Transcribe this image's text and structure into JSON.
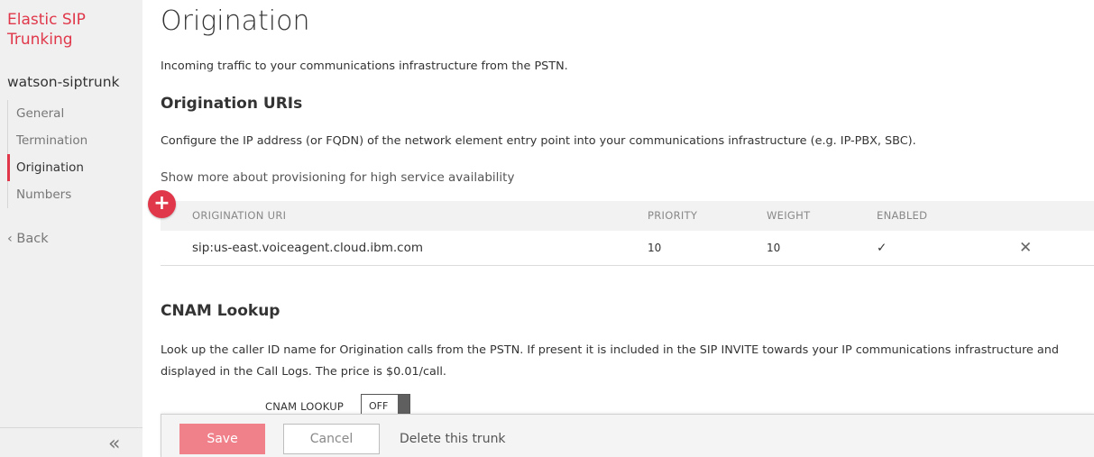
{
  "sidebar": {
    "app_title": "Elastic SIP Trunking",
    "trunk_name": "watson-siptrunk",
    "items": [
      {
        "label": "General"
      },
      {
        "label": "Termination"
      },
      {
        "label": "Origination"
      },
      {
        "label": "Numbers"
      }
    ],
    "active_item": "Origination",
    "back_label": "Back",
    "back_icon": "chevron-left-icon",
    "collapse_label": "«"
  },
  "page": {
    "title": "Origination",
    "intro": "Incoming traffic to your communications infrastructure from the PSTN."
  },
  "origination_uris": {
    "title": "Origination URIs",
    "description": "Configure the IP address (or FQDN) of the network element entry point into your communications infrastructure (e.g. IP-PBX, SBC).",
    "show_more": "Show more about provisioning for high service availability",
    "add_icon": "plus-icon",
    "columns": {
      "uri": "ORIGINATION URI",
      "priority": "PRIORITY",
      "weight": "WEIGHT",
      "enabled": "ENABLED"
    },
    "rows": [
      {
        "uri": "sip:us-east.voiceagent.cloud.ibm.com",
        "priority": "10",
        "weight": "10",
        "enabled": "✓",
        "delete": "✕"
      }
    ]
  },
  "cnam": {
    "title": "CNAM Lookup",
    "description": "Look up the caller ID name for Origination calls from the PSTN. If present it is included in the SIP INVITE towards your IP communications infrastructure and displayed in the Call Logs. The price is $0.01/call.",
    "toggle_label": "CNAM LOOKUP",
    "toggle_value": "OFF"
  },
  "footer": {
    "save_label": "Save",
    "cancel_label": "Cancel",
    "delete_label": "Delete this trunk"
  },
  "colors": {
    "accent": "#e0384a",
    "save_button": "#f0808a",
    "sidebar_bg": "#f0f0f0"
  }
}
